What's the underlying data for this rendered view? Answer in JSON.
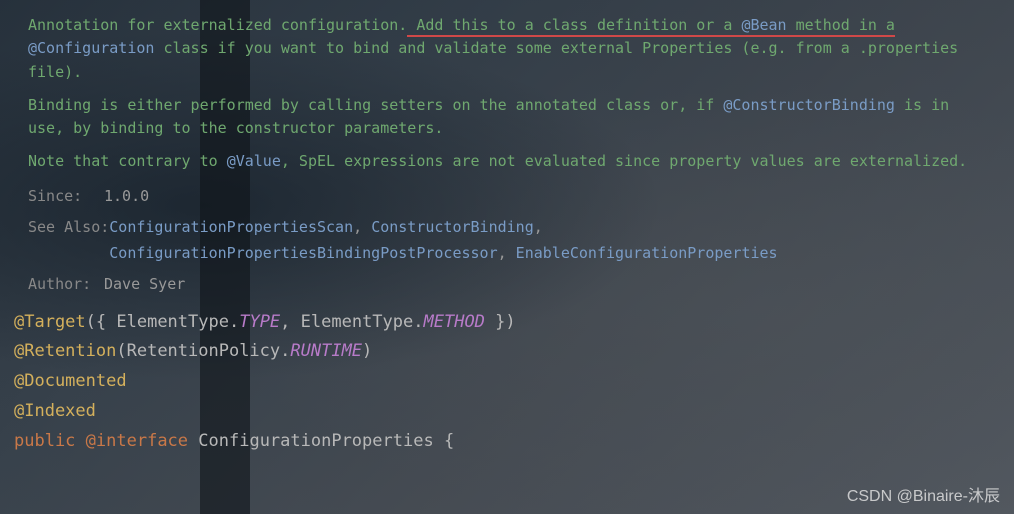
{
  "doc": {
    "para1_pre": "Annotation for externalized configuration.",
    "para1_underlined": " Add this to a class definition or a ",
    "para1_code1": "@Bean",
    "para1_underlined2": " method in a ",
    "para1_code2": "@Configuration",
    "para1_post": " class if you want to bind and validate some external Properties (e.g. from a .properties file).",
    "para2_pre": "Binding is either performed by calling setters on the annotated class or, if ",
    "para2_link": "@ConstructorBinding",
    "para2_post": " is in use, by binding to the constructor parameters.",
    "para3_pre": "Note that contrary to ",
    "para3_code": "@Value",
    "para3_post": ", SpEL expressions are not evaluated since property values are externalized."
  },
  "meta": {
    "since_label": "Since:",
    "since_value": "1.0.0",
    "see_also_label": "See Also:",
    "see_also": {
      "l1": "ConfigurationPropertiesScan",
      "l2": "ConstructorBinding",
      "l3": "ConfigurationPropertiesBindingPostProcessor",
      "l4": "EnableConfigurationProperties"
    },
    "author_label": "Author:",
    "author_value": "Dave Syer"
  },
  "code": {
    "at_target": "@Target",
    "element_type": "ElementType",
    "type_const": "TYPE",
    "method_const": "METHOD",
    "at_retention": "@Retention",
    "retention_policy": "RetentionPolicy",
    "runtime_const": "RUNTIME",
    "at_documented": "@Documented",
    "at_indexed": "@Indexed",
    "kw_public": "public",
    "kw_at_interface": "@interface",
    "classname": "ConfigurationProperties",
    "open_brace": "{"
  },
  "watermark": "CSDN @Binaire-沐辰",
  "sep": ", ",
  "dot": ".",
  "paren_open": "(",
  "paren_close": ")",
  "brace_open": "{",
  "brace_close": "}",
  "brace_open_sp": "({ ",
  "brace_close_sp": " })",
  "space": " "
}
